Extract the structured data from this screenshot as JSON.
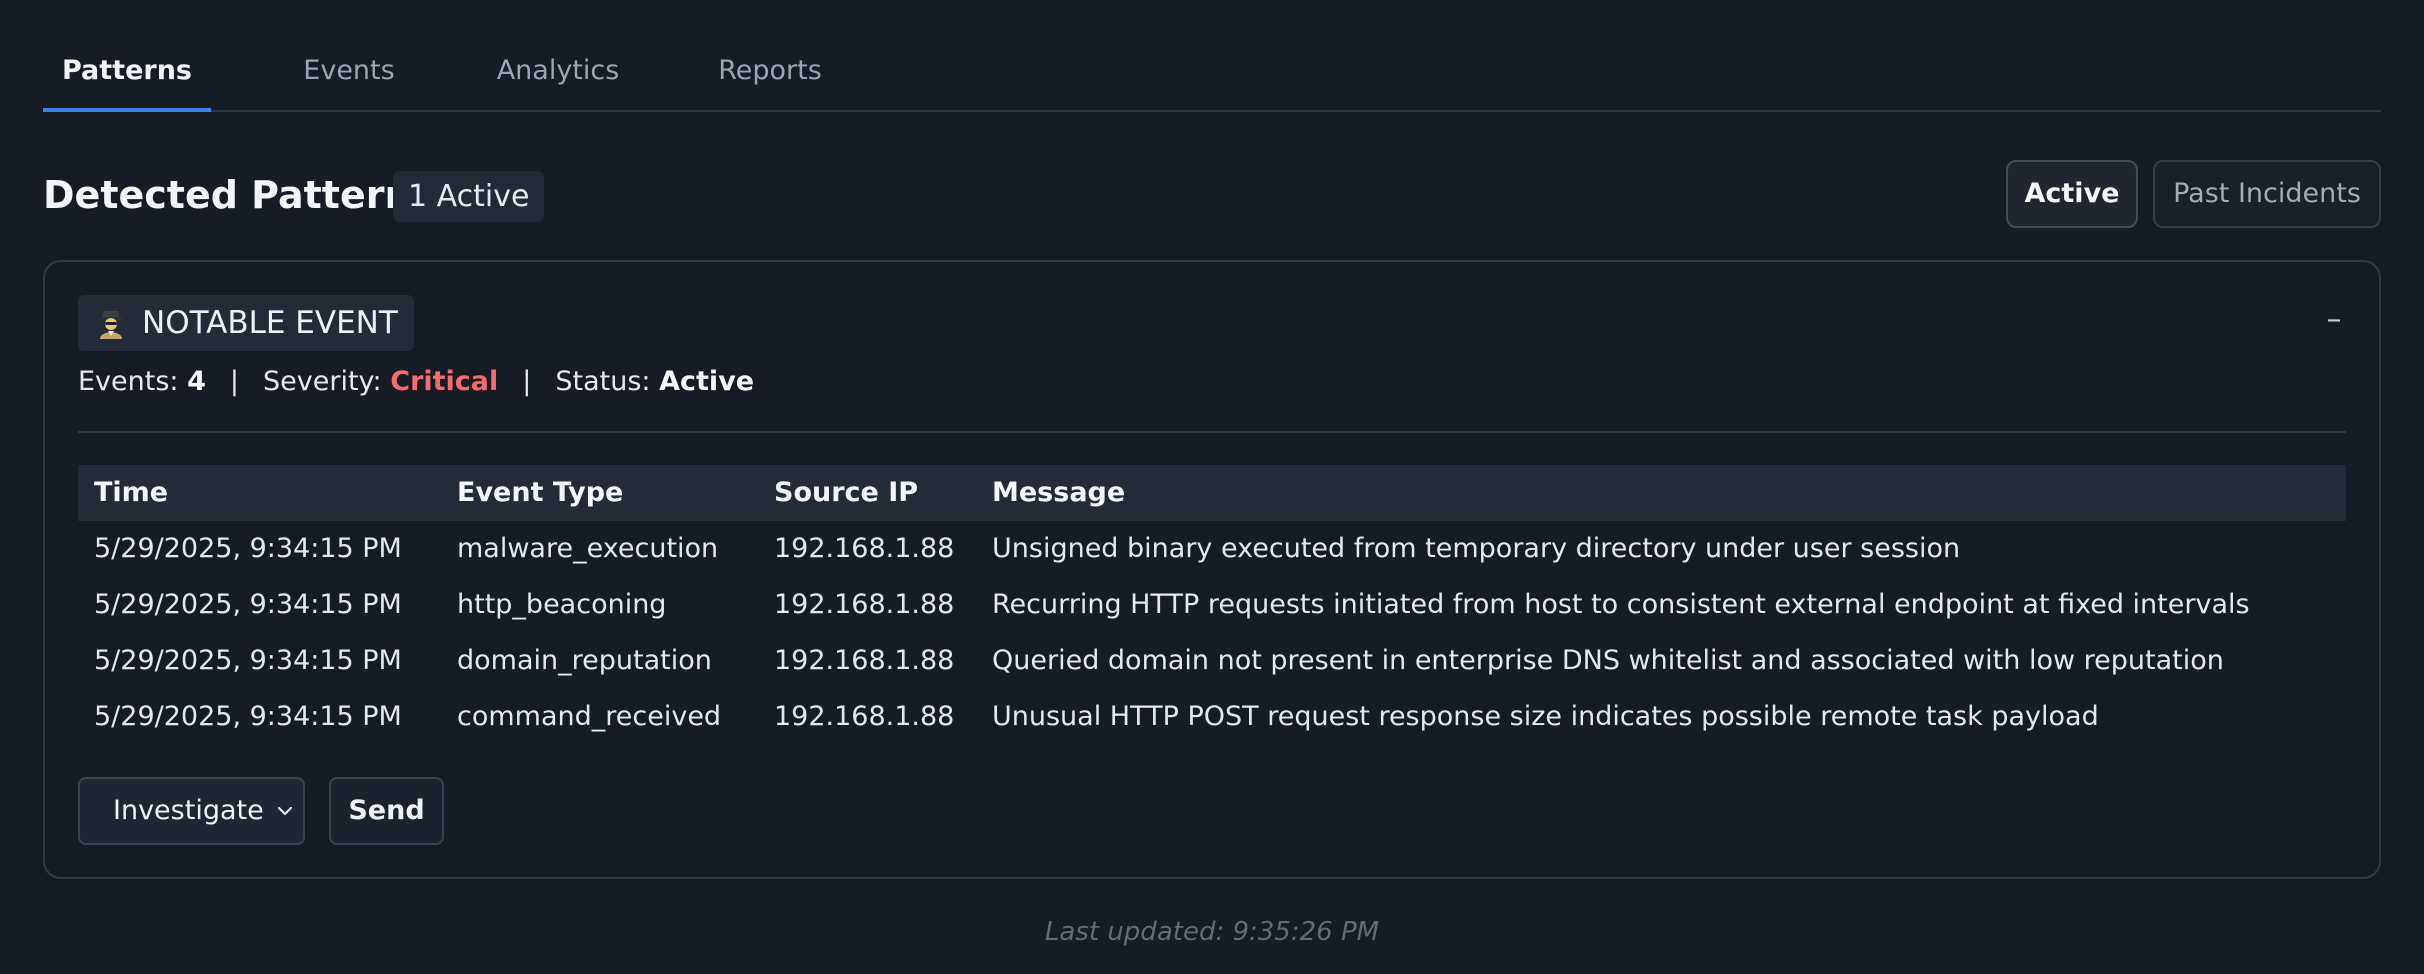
{
  "tabs": [
    {
      "label": "Patterns",
      "active": true
    },
    {
      "label": "Events",
      "active": false
    },
    {
      "label": "Analytics",
      "active": false
    },
    {
      "label": "Reports",
      "active": false
    }
  ],
  "header": {
    "title": "Detected Patterns",
    "active_count": "1 Active",
    "filters": {
      "active": "Active",
      "past": "Past Incidents"
    }
  },
  "card": {
    "badge_icon": "spy-icon",
    "badge_label": "NOTABLE EVENT",
    "collapse_symbol": "–",
    "meta": {
      "events_label": "Events:",
      "events_value": "4",
      "separator": "|",
      "severity_label": "Severity:",
      "severity_value": "Critical",
      "status_label": "Status:",
      "status_value": "Active"
    },
    "table": {
      "headers": [
        "Time",
        "Event Type",
        "Source IP",
        "Message"
      ],
      "rows": [
        [
          "5/29/2025, 9:34:15 PM",
          "malware_execution",
          "192.168.1.88",
          "Unsigned binary executed from temporary directory under user session"
        ],
        [
          "5/29/2025, 9:34:15 PM",
          "http_beaconing",
          "192.168.1.88",
          "Recurring HTTP requests initiated from host to consistent external endpoint at fixed intervals"
        ],
        [
          "5/29/2025, 9:34:15 PM",
          "domain_reputation",
          "192.168.1.88",
          "Queried domain not present in enterprise DNS whitelist and associated with low reputation"
        ],
        [
          "5/29/2025, 9:34:15 PM",
          "command_received",
          "192.168.1.88",
          "Unusual HTTP POST request response size indicates possible remote task payload"
        ]
      ]
    },
    "actions": {
      "select_value": "Investigate",
      "send_label": "Send"
    }
  },
  "footer": {
    "last_updated": "Last updated: 9:35:26 PM"
  },
  "colors": {
    "accent": "#3b82f6",
    "critical": "#f26d6d",
    "background": "#161b26"
  }
}
